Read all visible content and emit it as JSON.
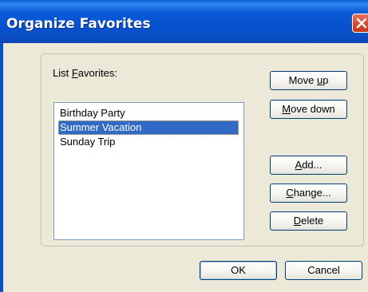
{
  "window": {
    "title": "Organize Favorites"
  },
  "dialog": {
    "list_label_prefix": "List ",
    "list_label_mnemonic": "F",
    "list_label_suffix": "avorites:",
    "favorites": [
      {
        "label": "Birthday Party",
        "selected": false
      },
      {
        "label": "Summer Vacation",
        "selected": true
      },
      {
        "label": "Sunday Trip",
        "selected": false
      }
    ],
    "buttons": {
      "move_up": {
        "pre": "Move ",
        "key": "u",
        "post": "p"
      },
      "move_down": {
        "pre": "",
        "key": "M",
        "post": "ove down"
      },
      "add": {
        "pre": "",
        "key": "A",
        "post": "dd..."
      },
      "change": {
        "pre": "",
        "key": "C",
        "post": "hange..."
      },
      "delete": {
        "pre": "",
        "key": "D",
        "post": "elete"
      },
      "ok": "OK",
      "cancel": "Cancel"
    }
  },
  "colors": {
    "titlebar": "#0a4fc6",
    "selection": "#316ac5",
    "dialog_bg": "#ece9d8",
    "close_button": "#d3482c"
  },
  "icons": {
    "close": "close-icon"
  }
}
